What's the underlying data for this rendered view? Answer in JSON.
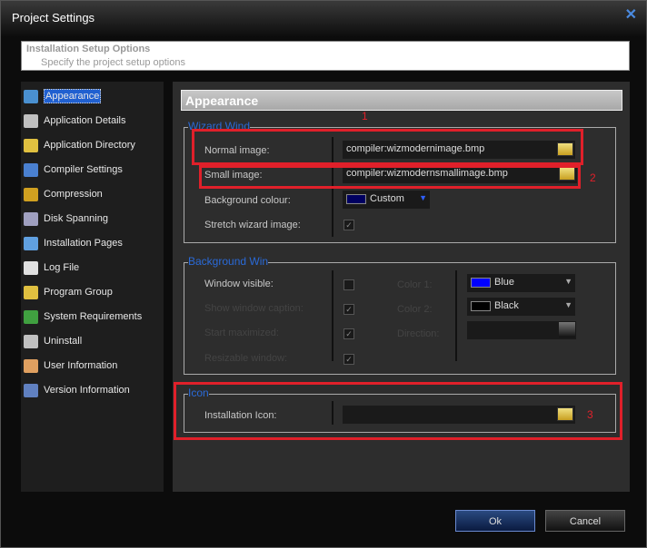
{
  "window": {
    "title": "Project Settings"
  },
  "header": {
    "title": "Installation Setup Options",
    "subtitle": "Specify the project setup options"
  },
  "sidebar": {
    "items": [
      {
        "label": "Appearance",
        "icon": "appearance-icon",
        "color": "#4a90d0"
      },
      {
        "label": "Application Details",
        "icon": "application-details-icon",
        "color": "#c0c0c0"
      },
      {
        "label": "Application Directory",
        "icon": "folder-icon",
        "color": "#e0c040"
      },
      {
        "label": "Compiler Settings",
        "icon": "compiler-icon",
        "color": "#4a80d0"
      },
      {
        "label": "Compression",
        "icon": "compression-icon",
        "color": "#d0a020"
      },
      {
        "label": "Disk Spanning",
        "icon": "disk-icon",
        "color": "#a0a0c0"
      },
      {
        "label": "Installation Pages",
        "icon": "pages-icon",
        "color": "#60a0e0"
      },
      {
        "label": "Log File",
        "icon": "log-file-icon",
        "color": "#e0e0e0"
      },
      {
        "label": "Program Group",
        "icon": "program-group-icon",
        "color": "#e0c040"
      },
      {
        "label": "System Requirements",
        "icon": "windows-icon",
        "color": "#40a040"
      },
      {
        "label": "Uninstall",
        "icon": "uninstall-icon",
        "color": "#c0c0c0"
      },
      {
        "label": "User Information",
        "icon": "user-icon",
        "color": "#e0a060"
      },
      {
        "label": "Version Information",
        "icon": "info-icon",
        "color": "#6080c0"
      }
    ]
  },
  "panel": {
    "title": "Appearance",
    "wizard": {
      "label": "Wizard Wind",
      "normal_label": "Normal image:",
      "normal_value": "compiler:wizmodernimage.bmp",
      "small_label": "Small image:",
      "small_value": "compiler:wizmodernsmallimage.bmp",
      "bg_label": "Background colour:",
      "bg_value": "Custom",
      "bg_color": "#000060",
      "stretch_label": "Stretch wizard image:",
      "stretch_checked": true
    },
    "background": {
      "label": "Background Win",
      "visible_label": "Window visible:",
      "caption_label": "Show window caption:",
      "max_label": "Start maximized:",
      "resize_label": "Resizable window:",
      "color1_label": "Color 1:",
      "color1_value": "Blue",
      "color1": "#0000ff",
      "color2_label": "Color 2:",
      "color2_value": "Black",
      "color2": "#000000",
      "direction_label": "Direction:"
    },
    "icon": {
      "label": "Icon",
      "install_label": "Installation Icon:",
      "install_value": ""
    }
  },
  "annotations": [
    "1",
    "2",
    "3"
  ],
  "buttons": {
    "ok": "Ok",
    "cancel": "Cancel"
  }
}
